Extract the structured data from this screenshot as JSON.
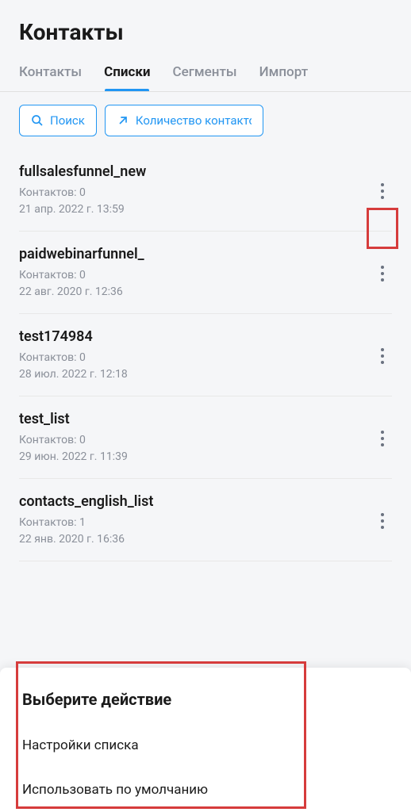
{
  "page": {
    "title": "Контакты"
  },
  "tabs": [
    {
      "label": "Контакты",
      "active": false
    },
    {
      "label": "Списки",
      "active": true
    },
    {
      "label": "Сегменты",
      "active": false
    },
    {
      "label": "Импорт",
      "active": false
    }
  ],
  "toolbar": {
    "search_label": "Поиск",
    "count_label": "Количество контактов"
  },
  "lists": [
    {
      "name": "fullsalesfunnel_new",
      "contacts_label": "Контактов: 0",
      "date": "21 апр. 2022 г. 13:59"
    },
    {
      "name": "paidwebinarfunnel_",
      "contacts_label": "Контактов: 0",
      "date": "22 авг. 2020 г. 12:36"
    },
    {
      "name": "test174984",
      "contacts_label": "Контактов: 0",
      "date": "28 июл. 2022 г. 12:18"
    },
    {
      "name": "test_list",
      "contacts_label": "Контактов: 0",
      "date": "29 июн. 2022 г. 11:39"
    },
    {
      "name": "contacts_english_list",
      "contacts_label": "Контактов: 1",
      "date": "22 янв. 2020 г. 16:36"
    }
  ],
  "action_sheet": {
    "title": "Выберите действие",
    "items": [
      "Настройки списка",
      "Использовать по умолчанию"
    ]
  }
}
